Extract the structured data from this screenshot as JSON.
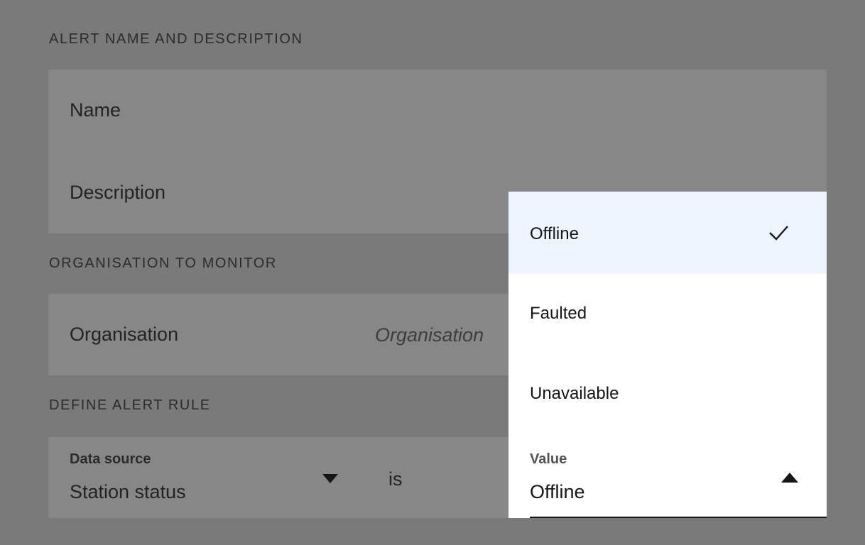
{
  "sections": {
    "name_description": "ALERT NAME AND DESCRIPTION",
    "organisation": "ORGANISATION TO MONITOR",
    "alert_rule": "DEFINE ALERT RULE"
  },
  "fields": {
    "name_label": "Name",
    "description_label": "Description",
    "organisation_label": "Organisation",
    "organisation_placeholder": "Organisation"
  },
  "rule": {
    "data_source_label": "Data source",
    "data_source_value": "Station status",
    "operator": "is",
    "value_label": "Value",
    "value_selected": "Offline"
  },
  "dropdown": {
    "options": [
      "Offline",
      "Faulted",
      "Unavailable"
    ],
    "selected_index": 0
  },
  "icons": {
    "check": "checkmark-icon",
    "caret_down": "caret-down-icon",
    "caret_up": "caret-up-icon"
  },
  "colors": {
    "overlay_bg": "#7a7a7a",
    "selected_option_bg": "#edf4fe",
    "text": "#161616"
  }
}
